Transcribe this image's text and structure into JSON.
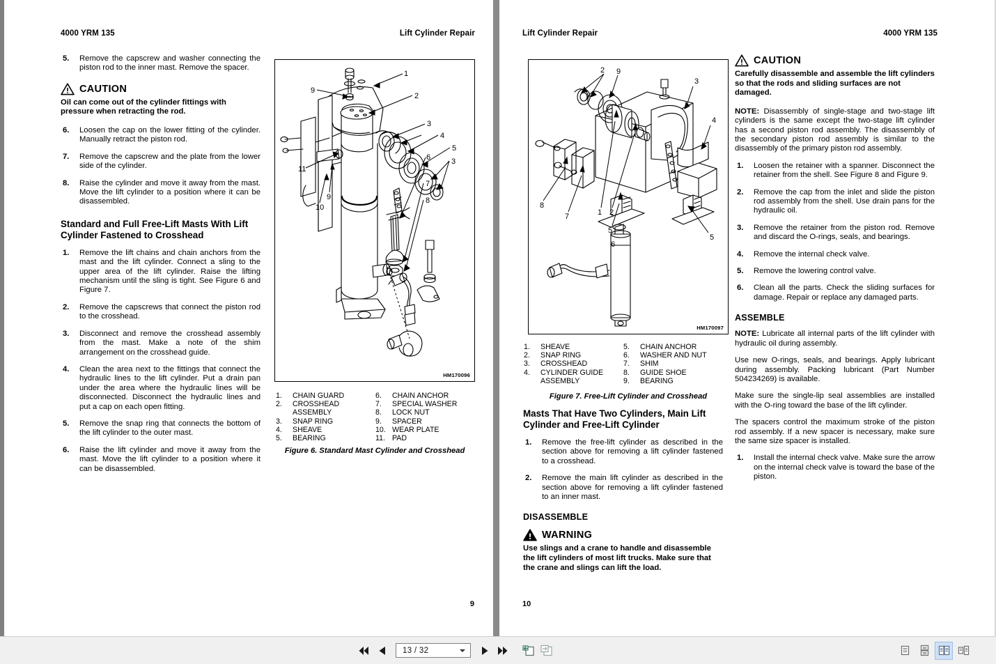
{
  "document": {
    "manual_code": "4000 YRM 135",
    "section_title": "Lift Cylinder Repair"
  },
  "left_page": {
    "header_left": "4000 YRM 135",
    "header_right": "Lift Cylinder Repair",
    "folio": "9",
    "col1": {
      "item5": {
        "num": "5.",
        "text": "Remove the capscrew and washer connecting the piston rod to the inner mast. Remove the spacer."
      },
      "caution": {
        "label": "CAUTION",
        "icon": "caution-triangle-icon",
        "body": "Oil can come out of the cylinder fittings with pressure when retracting the rod."
      },
      "item6": {
        "num": "6.",
        "text": "Loosen the cap on the lower fitting of the cylinder. Manually retract the piston rod."
      },
      "item7": {
        "num": "7.",
        "text": "Remove the capscrew and the plate from the lower side of the cylinder."
      },
      "item8": {
        "num": "8.",
        "text": "Raise the cylinder and move it away from the mast. Move the lift cylinder to a position where it can be disassembled."
      },
      "heading": "Standard and Full Free-Lift Masts With Lift Cylinder Fastened to Crosshead",
      "item1": {
        "num": "1.",
        "text": "Remove the lift chains and chain anchors from the mast and the lift cylinder.  Connect a sling to the upper area of the lift cylinder.  Raise the lifting mechanism until the sling is tight.  See Figure 6 and Figure 7."
      },
      "item2": {
        "num": "2.",
        "text": "Remove the capscrews that connect the piston rod to the crosshead."
      },
      "item3": {
        "num": "3.",
        "text": "Disconnect and remove the crosshead assembly from the mast.  Make a note of the shim arrangement on the crosshead guide."
      },
      "item4": {
        "num": "4.",
        "text": "Clean the area next to the fittings that connect the hydraulic lines to the lift cylinder.  Put a drain pan under the area where the hydraulic lines will be disconnected.  Disconnect the hydraulic lines and put a cap on each open fitting."
      },
      "item5b": {
        "num": "5.",
        "text": "Remove the snap ring that connects the bottom of the lift cylinder to the outer mast."
      },
      "item6b": {
        "num": "6.",
        "text": "Raise the lift cylinder and move it away from the mast.  Move the lift cylinder to a position where it can be disassembled."
      }
    },
    "figure6": {
      "image_id": "HM170096",
      "caption": "Figure 6. Standard Mast Cylinder and Crosshead",
      "legend_left": [
        {
          "n": "1.",
          "t": "CHAIN GUARD"
        },
        {
          "n": "2.",
          "t": "CROSSHEAD"
        },
        {
          "n": "",
          "t": "ASSEMBLY"
        },
        {
          "n": "3.",
          "t": "SNAP RING"
        },
        {
          "n": "4.",
          "t": "SHEAVE"
        },
        {
          "n": "5.",
          "t": "BEARING"
        }
      ],
      "legend_right": [
        {
          "n": "6.",
          "t": "CHAIN ANCHOR"
        },
        {
          "n": "7.",
          "t": "SPECIAL WASHER"
        },
        {
          "n": "8.",
          "t": "LOCK NUT"
        },
        {
          "n": "9.",
          "t": "SPACER"
        },
        {
          "n": "10.",
          "t": "WEAR PLATE"
        },
        {
          "n": "11.",
          "t": "PAD"
        }
      ]
    }
  },
  "right_page": {
    "header_left": "Lift Cylinder Repair",
    "header_right": "4000 YRM 135",
    "folio": "10",
    "figure7": {
      "image_id": "HM170097",
      "caption": "Figure 7. Free-Lift Cylinder and Crosshead",
      "legend_left": [
        {
          "n": "1.",
          "t": "SHEAVE"
        },
        {
          "n": "2.",
          "t": "SNAP RING"
        },
        {
          "n": "3.",
          "t": "CROSSHEAD"
        },
        {
          "n": "4.",
          "t": "CYLINDER GUIDE"
        },
        {
          "n": "",
          "t": "ASSEMBLY"
        }
      ],
      "legend_right": [
        {
          "n": "5.",
          "t": "CHAIN ANCHOR"
        },
        {
          "n": "6.",
          "t": "WASHER AND NUT"
        },
        {
          "n": "7.",
          "t": "SHIM"
        },
        {
          "n": "8.",
          "t": "GUIDE SHOE"
        },
        {
          "n": "9.",
          "t": "BEARING"
        }
      ]
    },
    "col1": {
      "heading": "Masts That Have Two Cylinders, Main Lift Cylinder and Free-Lift Cylinder",
      "item1": {
        "num": "1.",
        "text": "Remove the free-lift cylinder as described in the section above for removing a lift cylinder fastened to a crosshead."
      },
      "item2": {
        "num": "2.",
        "text": "Remove the main lift cylinder as described in the section above for removing a lift cylinder fastened to an inner mast."
      },
      "disassemble_heading": "DISASSEMBLE",
      "warning": {
        "label": "WARNING",
        "icon": "warning-triangle-icon",
        "body": "Use slings and a crane to handle and disassemble the lift cylinders of most lift trucks. Make sure that the crane and slings can lift the load."
      }
    },
    "col2": {
      "caution": {
        "label": "CAUTION",
        "icon": "caution-triangle-icon",
        "body": "Carefully disassemble and assemble the lift cylinders so that the rods and sliding surfaces are not damaged."
      },
      "note1_label": "NOTE:",
      "note1_text": " Disassembly of single-stage and two-stage lift cylinders is the same except the two-stage lift cylinder has a second piston rod assembly.  The disassembly of the secondary piston rod assembly is similar to the disassembly of the primary piston rod assembly.",
      "item1": {
        "num": "1.",
        "text": "Loosen the retainer with a spanner. Disconnect the retainer from the shell. See Figure 8 and Figure 9."
      },
      "item2": {
        "num": "2.",
        "text": "Remove the cap from the inlet and slide the piston rod assembly from the shell.  Use drain pans for the hydraulic oil."
      },
      "item3": {
        "num": "3.",
        "text": "Remove the retainer from the piston rod.  Remove and discard the O-rings, seals, and bearings."
      },
      "item4": {
        "num": "4.",
        "text": "Remove the internal check valve."
      },
      "item5": {
        "num": "5.",
        "text": "Remove the lowering control valve."
      },
      "item6": {
        "num": "6.",
        "text": "Clean all the parts.  Check the sliding surfaces for damage. Repair or replace any damaged parts."
      },
      "assemble_heading": "ASSEMBLE",
      "note2_label": "NOTE:",
      "note2_text": " Lubricate all internal parts of the lift cylinder with hydraulic oil during assembly.",
      "para1": "Use new O-rings, seals, and bearings.   Apply lubricant during assembly.  Packing lubricant (Part Number 504234269) is available.",
      "para2": "Make sure the single-lip seal assemblies are installed with the O-ring toward the base of the lift cylinder.",
      "para3": "The spacers control the maximum stroke of the piston rod assembly. If a new spacer is necessary, make sure the same size spacer is installed.",
      "a_item1": {
        "num": "1.",
        "text": "Install the internal check valve.  Make sure the arrow on the internal check valve is toward the base of the piston."
      }
    }
  },
  "toolbar": {
    "first_page_label": "first-page",
    "prev_page_label": "previous-page",
    "page_value": "13 / 32",
    "next_page_label": "next-page",
    "last_page_label": "last-page",
    "export_label": "export-page",
    "copy_label": "copy-page",
    "view_single": "single-page-view",
    "view_continuous": "continuous-view",
    "view_two_page": "two-page-view",
    "view_book": "book-view",
    "active_view": "two-page-view",
    "accent_color": "#cfe0f5"
  }
}
